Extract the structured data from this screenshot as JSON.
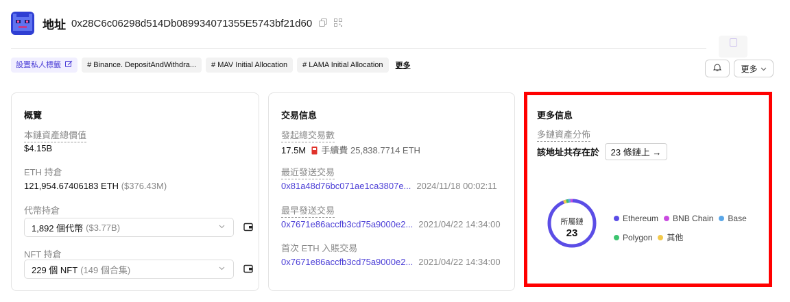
{
  "header": {
    "title": "地址",
    "address": "0x28C6c06298d514Db089934071355E5743bf21d60"
  },
  "tags": {
    "private_label": "設置私人標籤",
    "items": [
      "# Binance. DepositAndWithdra...",
      "# MAV Initial Allocation",
      "# LAMA Initial Allocation"
    ],
    "more": "更多"
  },
  "actions": {
    "more_label": "更多"
  },
  "overview": {
    "title": "概覽",
    "total_label": "本鏈資產總價值",
    "total_value": "$4.15B",
    "eth_label": "ETH 持倉",
    "eth_value": "121,954.67406183 ETH",
    "eth_usd": "($376.43M)",
    "token_label": "代幣持倉",
    "token_value": "1,892 個代幣",
    "token_usd": "($3.77B)",
    "nft_label": "NFT 持倉",
    "nft_value": "229 個 NFT",
    "nft_sets": "(149 個合集)"
  },
  "tx": {
    "title": "交易信息",
    "count_label": "發起總交易數",
    "count_value": "17.5M",
    "fee_text": "手續費 25,838.7714 ETH",
    "latest_label": "最近發送交易",
    "latest_hash": "0x81a48d76bc071ae1ca3807e...",
    "latest_time": "2024/11/18 00:02:11",
    "earliest_label": "最早發送交易",
    "earliest_hash": "0x7671e86accfb3cd75a9000e2...",
    "earliest_time": "2021/04/22 14:34:00",
    "first_in_label": "首次 ETH 入賬交易",
    "first_in_hash": "0x7671e86accfb3cd75a9000e2...",
    "first_in_time": "2021/04/22 14:34:00"
  },
  "more_info": {
    "title": "更多信息",
    "multichain_label": "多鏈資產分佈",
    "exists_text": "該地址共存在於",
    "chains_button": "23 條鏈上 →",
    "donut_label": "所屬鏈",
    "donut_count": "23",
    "legend": [
      {
        "name": "Ethereum",
        "color": "#5b4de6"
      },
      {
        "name": "BNB Chain",
        "color": "#c94be0"
      },
      {
        "name": "Base",
        "color": "#5aa7e8"
      },
      {
        "name": "Polygon",
        "color": "#3cc46f"
      },
      {
        "name": "其他",
        "color": "#f2c94c"
      }
    ]
  },
  "colors": {
    "accent": "#4b3ed6",
    "highlight_border": "#ff0000"
  }
}
